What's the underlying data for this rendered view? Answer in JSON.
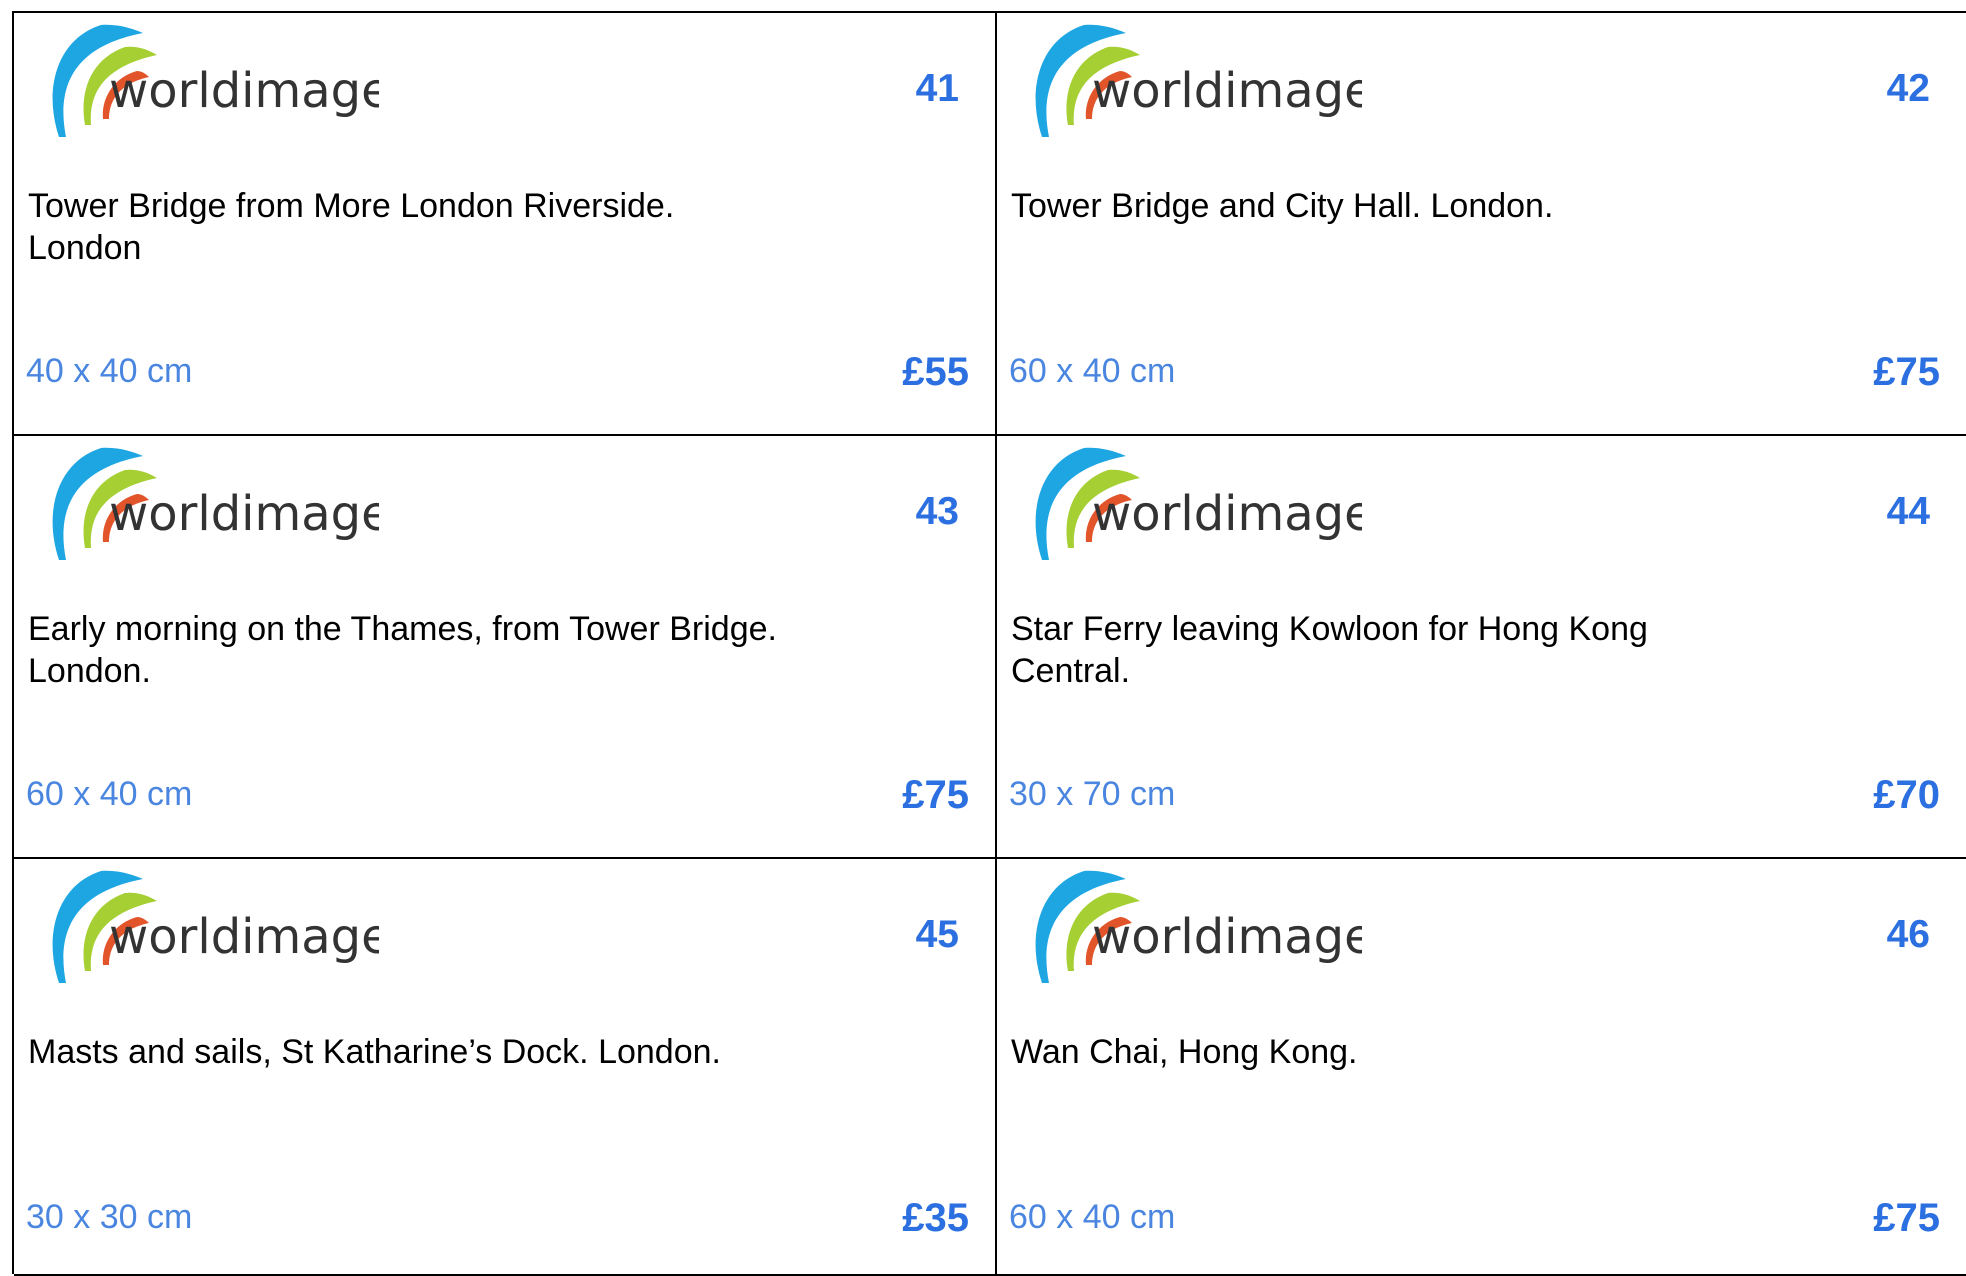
{
  "brand": {
    "name": "worldimage",
    "colors": {
      "blue": "#1ea6e3",
      "green": "#a5cf33",
      "red": "#e2542a",
      "text": "#333333"
    }
  },
  "cards": [
    {
      "lot": "41",
      "description": "Tower Bridge from More London Riverside. London",
      "size": "40 x 40 cm",
      "price": "£55"
    },
    {
      "lot": "42",
      "description": "Tower Bridge and City Hall. London.",
      "size": "60 x 40 cm",
      "price": "£75"
    },
    {
      "lot": "43",
      "description": "Early morning on the Thames, from Tower Bridge. London.",
      "size": "60 x 40 cm",
      "price": "£75"
    },
    {
      "lot": "44",
      "description": "Star Ferry leaving Kowloon for Hong Kong Central.",
      "size": "30 x 70 cm",
      "price": "£70"
    },
    {
      "lot": "45",
      "description": "Masts and sails, St Katharine’s Dock. London.",
      "size": "30 x 30 cm",
      "price": "£35"
    },
    {
      "lot": "46",
      "description": "Wan Chai, Hong Kong.",
      "size": "60 x 40 cm",
      "price": "£75"
    }
  ]
}
